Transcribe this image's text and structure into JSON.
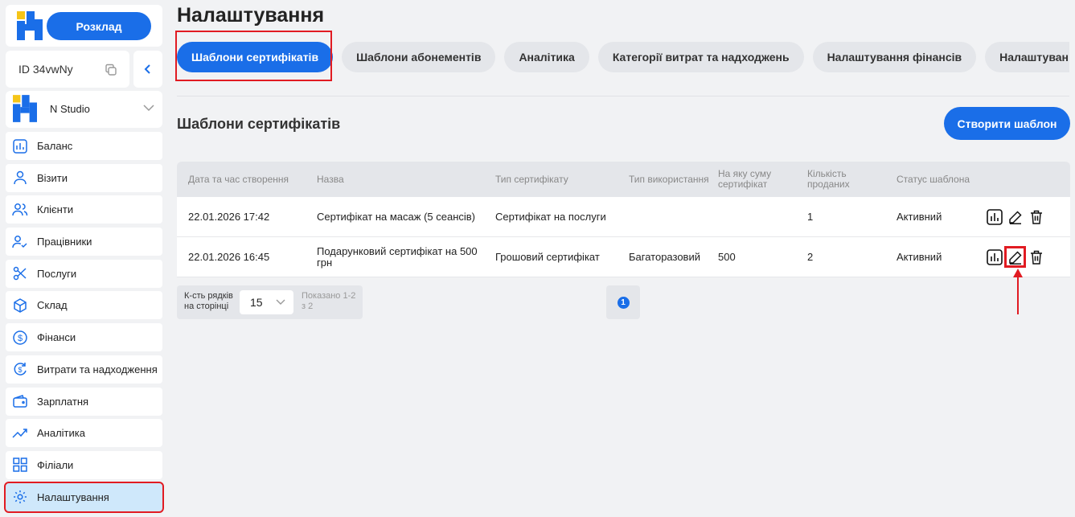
{
  "sidebar": {
    "schedule_label": "Розклад",
    "id_label": "ID 34vwNy",
    "studio_name": "N Studio",
    "items": [
      {
        "label": "Баланс",
        "icon": "chart-icon"
      },
      {
        "label": "Візити",
        "icon": "user-icon"
      },
      {
        "label": "Клієнти",
        "icon": "users-icon"
      },
      {
        "label": "Працівники",
        "icon": "employee-icon"
      },
      {
        "label": "Послуги",
        "icon": "scissors-icon"
      },
      {
        "label": "Склад",
        "icon": "box-icon"
      },
      {
        "label": "Фінанси",
        "icon": "dollar-icon"
      },
      {
        "label": "Витрати та надходження",
        "icon": "exchange-icon"
      },
      {
        "label": "Зарплатня",
        "icon": "wallet-icon"
      },
      {
        "label": "Аналітика",
        "icon": "trend-icon"
      },
      {
        "label": "Філіали",
        "icon": "grid-icon"
      },
      {
        "label": "Налаштування",
        "icon": "gear-icon"
      }
    ]
  },
  "header": {
    "title": "Налаштування"
  },
  "tabs": [
    {
      "label": "Шаблони сертифікатів"
    },
    {
      "label": "Шаблони абонементів"
    },
    {
      "label": "Аналітика"
    },
    {
      "label": "Категорії витрат та надходжень"
    },
    {
      "label": "Налаштування фінансів"
    },
    {
      "label": "Налаштування SMS"
    }
  ],
  "main": {
    "section_title": "Шаблони сертифікатів",
    "create_label": "Створити шаблон"
  },
  "table": {
    "headers": {
      "created": "Дата та час створення",
      "name": "Назва",
      "type": "Тип сертифікату",
      "usage": "Тип використання",
      "amount": "На яку суму сертифікат",
      "sold": "Кількість проданих",
      "status": "Статус шаблона"
    },
    "rows": [
      {
        "created": "22.01.2026 17:42",
        "name": "Сертифікат на масаж (5 сеансів)",
        "type": "Сертифікат на послуги",
        "usage": "",
        "amount": "",
        "sold": "1",
        "status": "Активний"
      },
      {
        "created": "22.01.2026 16:45",
        "name": "Подарунковий сертифікат на 500 грн",
        "type": "Грошовий сертифікат",
        "usage": "Багаторазовий",
        "amount": "500",
        "sold": "2",
        "status": "Активний"
      }
    ]
  },
  "pagination": {
    "rows_label": "К-сть рядків на сторінці",
    "rows_value": "15",
    "shown": "Показано 1-2 з 2",
    "page": "1"
  },
  "colors": {
    "accent": "#1a6ee8",
    "highlight": "#e11b22",
    "active_nav": "#cfe8fb"
  }
}
